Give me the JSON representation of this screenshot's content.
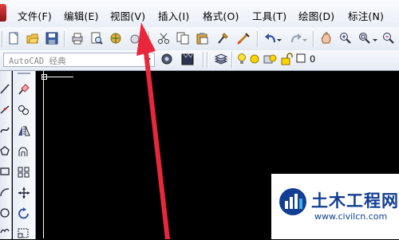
{
  "menubar": {
    "items": [
      "文件(F)",
      "编辑(E)",
      "视图(V)",
      "插入(I)",
      "格式(O)",
      "工具(T)",
      "绘图(D)",
      "标注(N)"
    ]
  },
  "toolbar2": {
    "workspace_value": "AutoCAD 经典",
    "current_layer": "0"
  },
  "watermark": {
    "title": "土木工程网",
    "url": "www.civilcn.com"
  },
  "colors": {
    "annotation_arrow": "#e8283a",
    "watermark_text": "#123e93",
    "drawing_area": "#000000"
  }
}
